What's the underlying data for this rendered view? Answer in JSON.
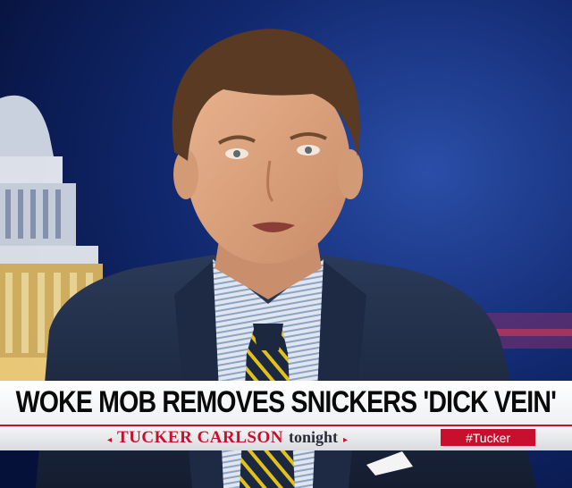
{
  "broadcast": {
    "headline": "WOKE MOB REMOVES SNICKERS 'DICK VEIN'",
    "show_name": "TUCKER CARLSON",
    "show_subtitle": "tonight",
    "hashtag": "#Tucker",
    "colors": {
      "accent_red": "#c8102e",
      "background_blue": "#0a1a4a",
      "bar_white": "#ffffff"
    }
  }
}
